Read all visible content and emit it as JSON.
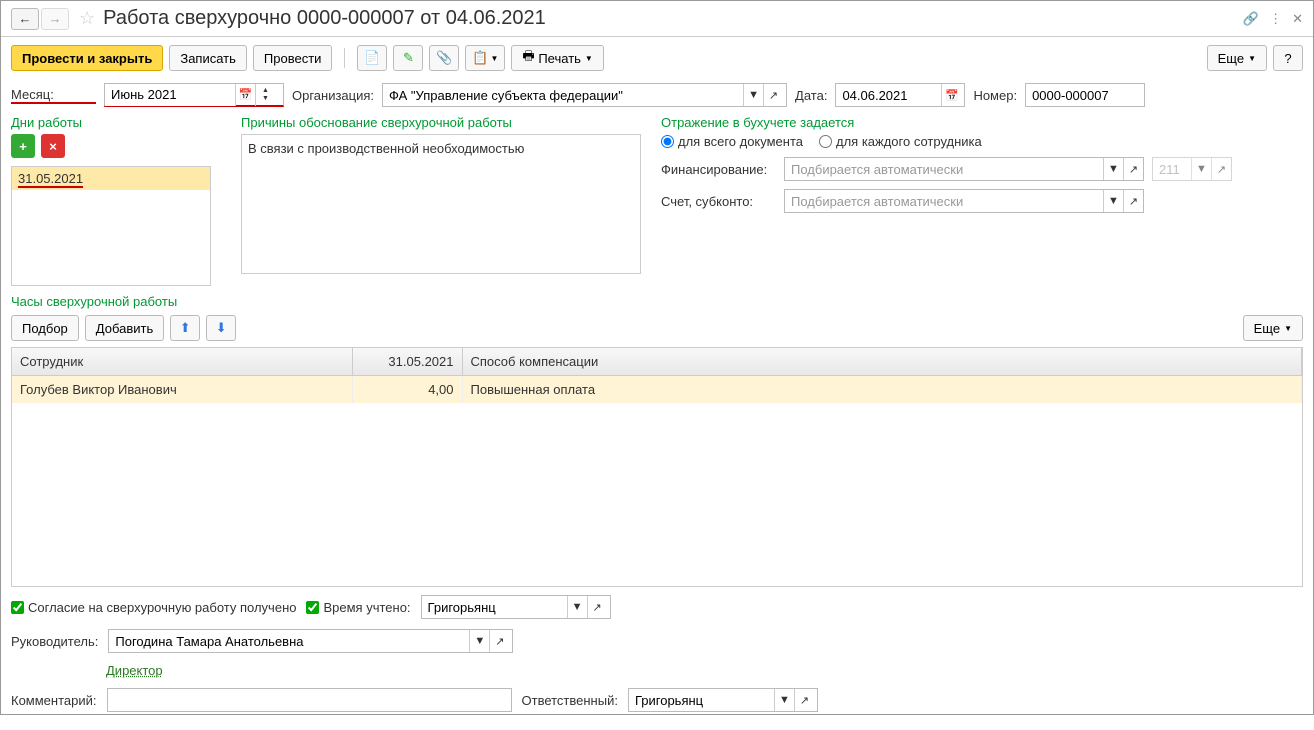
{
  "header": {
    "title": "Работа сверхурочно 0000-000007 от 04.06.2021"
  },
  "toolbar": {
    "post_close": "Провести и закрыть",
    "save": "Записать",
    "post": "Провести",
    "print": "Печать",
    "more": "Еще"
  },
  "form": {
    "month_label": "Месяц:",
    "month_value": "Июнь 2021",
    "org_label": "Организация:",
    "org_value": "ФА \"Управление субъекта федерации\"",
    "date_label": "Дата:",
    "date_value": "04.06.2021",
    "number_label": "Номер:",
    "number_value": "0000-000007"
  },
  "days": {
    "title": "Дни работы",
    "items": [
      "31.05.2021"
    ]
  },
  "reasons": {
    "title": "Причины обоснование сверхурочной работы",
    "text": "В связи с производственной необходимостью"
  },
  "accounting": {
    "title": "Отражение в бухучете задается",
    "radio_all": "для всего документа",
    "radio_each": "для каждого сотрудника",
    "financing_label": "Финансирование:",
    "financing_placeholder": "Подбирается автоматически",
    "account_code": "211",
    "account_label": "Счет, субконто:",
    "account_placeholder": "Подбирается автоматически"
  },
  "hours": {
    "title": "Часы сверхурочной работы",
    "pick": "Подбор",
    "add": "Добавить",
    "more": "Еще",
    "columns": {
      "employee": "Сотрудник",
      "date": "31.05.2021",
      "comp": "Способ компенсации"
    },
    "rows": [
      {
        "employee": "Голубев Виктор Иванович",
        "hours": "4,00",
        "comp": "Повышенная оплата"
      }
    ]
  },
  "bottom": {
    "consent": "Согласие на сверхурочную работу получено",
    "time_logged": "Время учтено:",
    "time_logged_value": "Григорьянц",
    "manager_label": "Руководитель:",
    "manager_value": "Погодина Тамара Анатольевна",
    "position": "Директор",
    "comment_label": "Комментарий:",
    "responsible_label": "Ответственный:",
    "responsible_value": "Григорьянц"
  }
}
